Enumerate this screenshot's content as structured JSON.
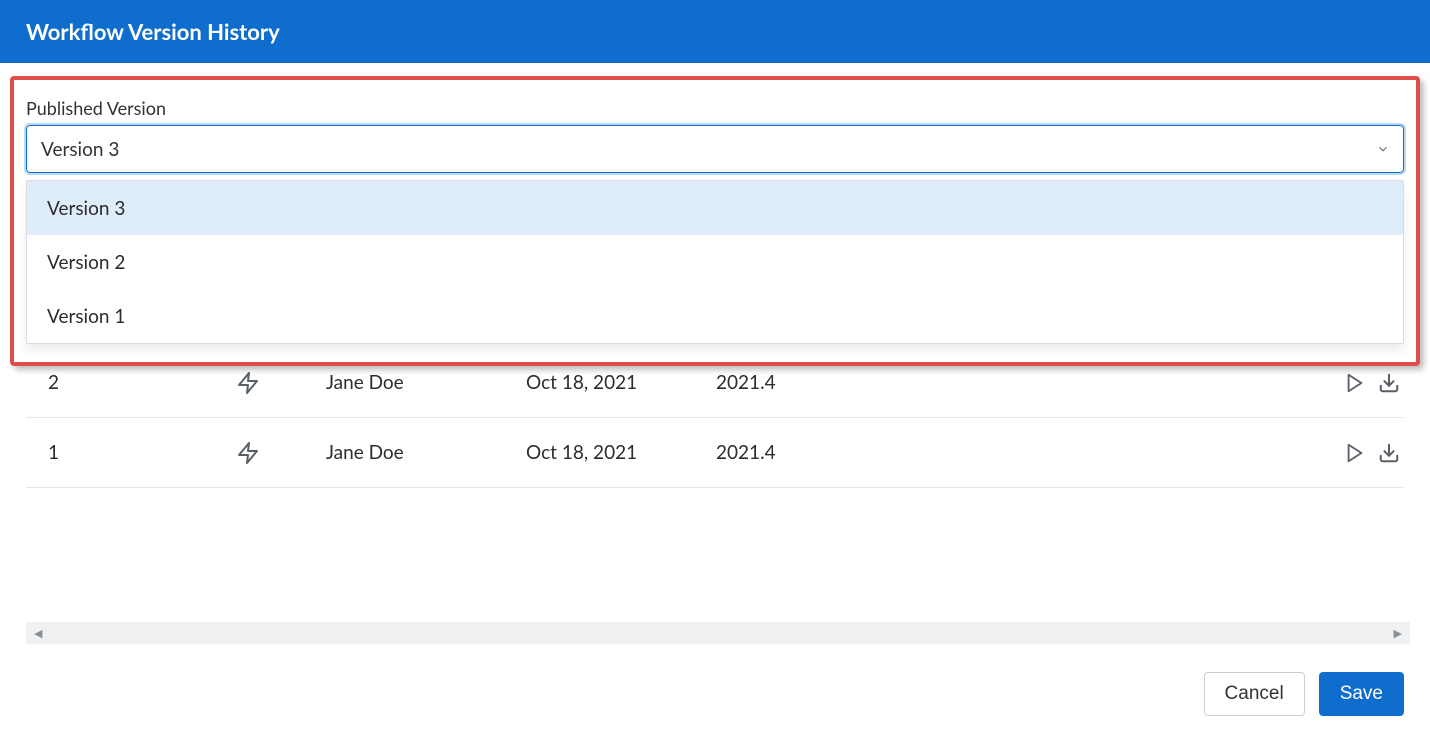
{
  "header": {
    "title": "Workflow Version History"
  },
  "publishedVersion": {
    "label": "Published Version",
    "selected": "Version 3",
    "options": [
      "Version 3",
      "Version 2",
      "Version 1"
    ]
  },
  "rows": [
    {
      "version": "2",
      "user": "Jane Doe",
      "date": "Oct 18, 2021",
      "release": "2021.4"
    },
    {
      "version": "1",
      "user": "Jane Doe",
      "date": "Oct 18, 2021",
      "release": "2021.4"
    }
  ],
  "footer": {
    "cancel": "Cancel",
    "save": "Save"
  }
}
